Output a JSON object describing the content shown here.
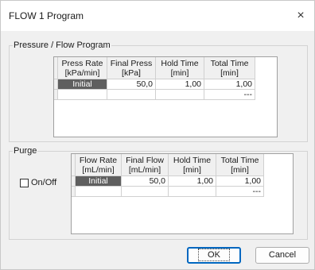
{
  "window": {
    "title": "FLOW 1 Program",
    "close_symbol": "×"
  },
  "pressure": {
    "legend": "Pressure / Flow Program",
    "columns": [
      {
        "line1": "Press Rate",
        "line2": "[kPa/min]"
      },
      {
        "line1": "Final Press",
        "line2": "[kPa]"
      },
      {
        "line1": "Hold Time",
        "line2": "[min]"
      },
      {
        "line1": "Total Time",
        "line2": "[min]"
      }
    ],
    "rows": [
      [
        "Initial",
        "50,0",
        "1,00",
        "1,00"
      ],
      [
        "",
        "",
        "",
        "---"
      ]
    ]
  },
  "purge": {
    "legend": "Purge",
    "onoff_label": "On/Off",
    "onoff_checked": false,
    "columns": [
      {
        "line1": "Flow Rate",
        "line2": "[mL/min]"
      },
      {
        "line1": "Final Flow",
        "line2": "[mL/min]"
      },
      {
        "line1": "Hold Time",
        "line2": "[min]"
      },
      {
        "line1": "Total Time",
        "line2": "[min]"
      }
    ],
    "rows": [
      [
        "Initial",
        "50,0",
        "1,00",
        "1,00"
      ],
      [
        "",
        "",
        "",
        "---"
      ]
    ]
  },
  "buttons": {
    "ok": "OK",
    "cancel": "Cancel"
  }
}
